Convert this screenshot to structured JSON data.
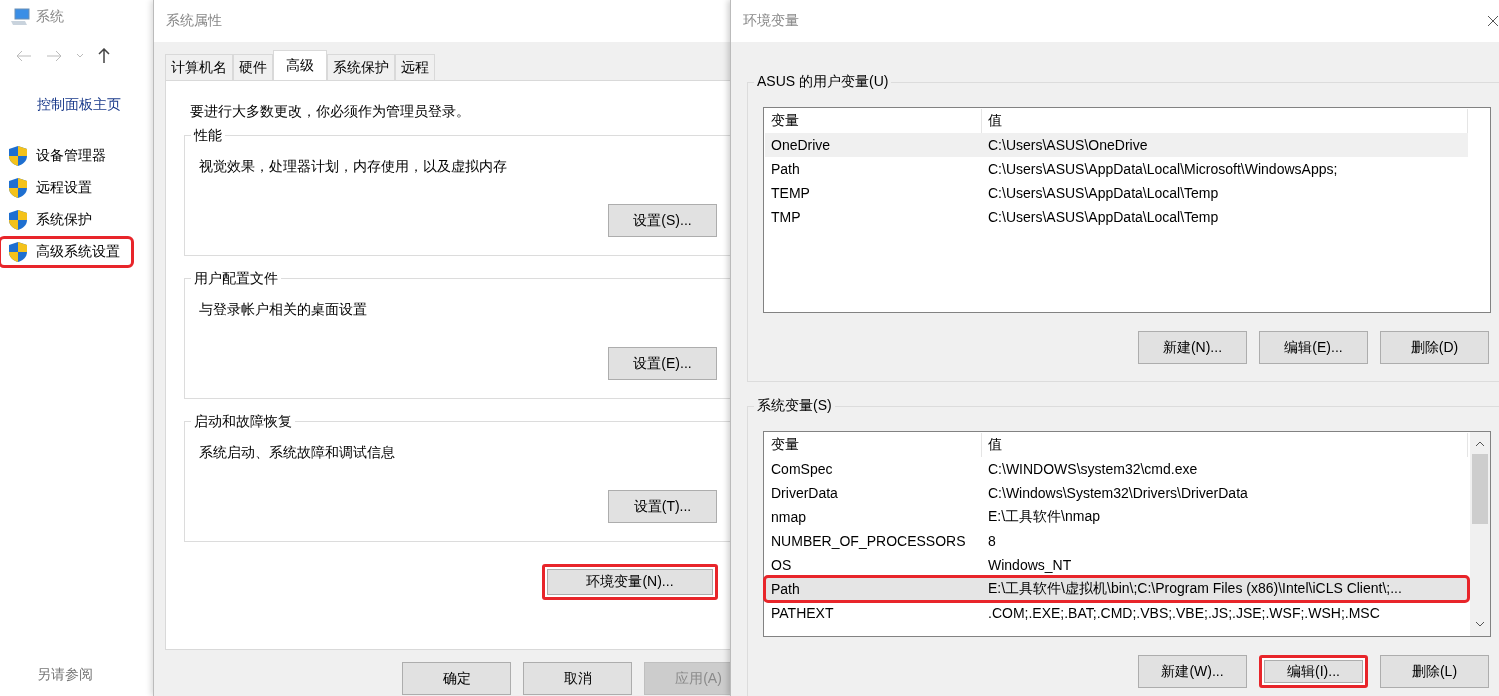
{
  "system_window": {
    "title": "系统",
    "sidebar": {
      "home_link": "控制面板主页",
      "items": [
        {
          "label": "设备管理器",
          "highlighted": false
        },
        {
          "label": "远程设置",
          "highlighted": false
        },
        {
          "label": "系统保护",
          "highlighted": false
        },
        {
          "label": "高级系统设置",
          "highlighted": true
        }
      ],
      "see_also": "另请参阅"
    }
  },
  "system_properties": {
    "title": "系统属性",
    "tabs": [
      {
        "label": "计算机名",
        "selected": false
      },
      {
        "label": "硬件",
        "selected": false
      },
      {
        "label": "高级",
        "selected": true
      },
      {
        "label": "系统保护",
        "selected": false
      },
      {
        "label": "远程",
        "selected": false
      }
    ],
    "notice": "要进行大多数更改，你必须作为管理员登录。",
    "groups": [
      {
        "title": "性能",
        "description": "视觉效果，处理器计划，内存使用，以及虚拟内存",
        "button": "设置(S)..."
      },
      {
        "title": "用户配置文件",
        "description": "与登录帐户相关的桌面设置",
        "button": "设置(E)..."
      },
      {
        "title": "启动和故障恢复",
        "description": "系统启动、系统故障和调试信息",
        "button": "设置(T)..."
      }
    ],
    "env_button": {
      "label": "环境变量(N)...",
      "highlighted": true
    },
    "footer_buttons": [
      {
        "label": "确定",
        "disabled": false
      },
      {
        "label": "取消",
        "disabled": false
      },
      {
        "label": "应用(A)",
        "disabled": true
      }
    ]
  },
  "environment_variables": {
    "title": "环境变量",
    "sections": [
      {
        "title": "ASUS 的用户变量(U)",
        "columns": [
          "变量",
          "值"
        ],
        "rows": [
          {
            "name": "OneDrive",
            "value": "C:\\Users\\ASUS\\OneDrive",
            "selected": true,
            "highlighted": false
          },
          {
            "name": "Path",
            "value": "C:\\Users\\ASUS\\AppData\\Local\\Microsoft\\WindowsApps;",
            "selected": false,
            "highlighted": false
          },
          {
            "name": "TEMP",
            "value": "C:\\Users\\ASUS\\AppData\\Local\\Temp",
            "selected": false,
            "highlighted": false
          },
          {
            "name": "TMP",
            "value": "C:\\Users\\ASUS\\AppData\\Local\\Temp",
            "selected": false,
            "highlighted": false
          }
        ],
        "buttons": [
          {
            "label": "新建(N)...",
            "highlighted": false
          },
          {
            "label": "编辑(E)...",
            "highlighted": false
          },
          {
            "label": "删除(D)",
            "highlighted": false
          }
        ]
      },
      {
        "title": "系统变量(S)",
        "columns": [
          "变量",
          "值"
        ],
        "rows": [
          {
            "name": "ComSpec",
            "value": "C:\\WINDOWS\\system32\\cmd.exe",
            "selected": false,
            "highlighted": false
          },
          {
            "name": "DriverData",
            "value": "C:\\Windows\\System32\\Drivers\\DriverData",
            "selected": false,
            "highlighted": false
          },
          {
            "name": "nmap",
            "value": "E:\\工具软件\\nmap",
            "selected": false,
            "highlighted": false
          },
          {
            "name": "NUMBER_OF_PROCESSORS",
            "value": "8",
            "selected": false,
            "highlighted": false
          },
          {
            "name": "OS",
            "value": "Windows_NT",
            "selected": false,
            "highlighted": false
          },
          {
            "name": "Path",
            "value": "E:\\工具软件\\虚拟机\\bin\\;C:\\Program Files (x86)\\Intel\\iCLS Client\\;...",
            "selected": true,
            "highlighted": true
          },
          {
            "name": "PATHEXT",
            "value": ".COM;.EXE;.BAT;.CMD;.VBS;.VBE;.JS;.JSE;.WSF;.WSH;.MSC",
            "selected": false,
            "highlighted": false
          }
        ],
        "buttons": [
          {
            "label": "新建(W)...",
            "highlighted": false
          },
          {
            "label": "编辑(I)...",
            "highlighted": true
          },
          {
            "label": "删除(L)",
            "highlighted": false
          }
        ]
      }
    ]
  }
}
